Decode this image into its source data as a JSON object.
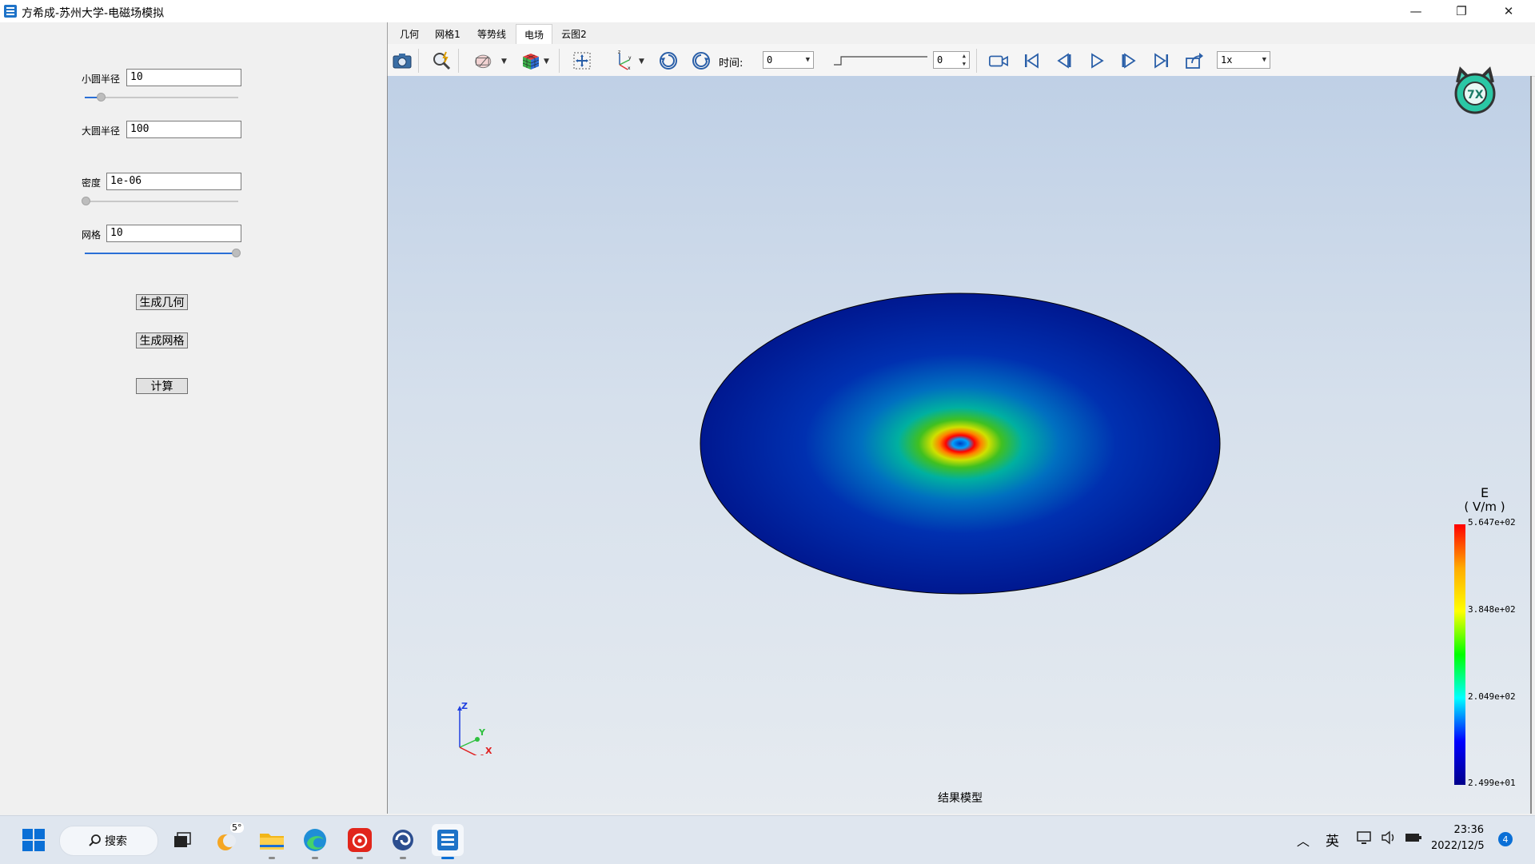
{
  "window": {
    "title": "方希成-苏州大学-电磁场模拟",
    "controls": {
      "minimize": "—",
      "restore": "❐",
      "close": "✕"
    }
  },
  "left_panel": {
    "fields": [
      {
        "label": "小圆半径",
        "value": "10"
      },
      {
        "label": "大圆半径",
        "value": "100"
      },
      {
        "label": "密度",
        "value": "1e-06"
      },
      {
        "label": "网格",
        "value": "10"
      }
    ],
    "sliders": {
      "inner_radius_level": 0.07,
      "density_level": 0.0,
      "grid_level": 1.0
    },
    "buttons": {
      "generate_geometry": "生成几何",
      "generate_mesh": "生成网格",
      "compute": "计算"
    }
  },
  "tabs": [
    {
      "label": "几何",
      "active": false
    },
    {
      "label": "网格1",
      "active": false
    },
    {
      "label": "等势线",
      "active": false
    },
    {
      "label": "电场",
      "active": true
    },
    {
      "label": "云图2",
      "active": false
    }
  ],
  "toolbar": {
    "time_label": "时间:",
    "time_value": "0",
    "step_value": "0",
    "speed_value": "1x"
  },
  "viewport": {
    "caption": "结果模型",
    "axes": {
      "z": "Z",
      "y": "Y",
      "x": "X"
    },
    "logo_text": "7X"
  },
  "colorbar": {
    "quantity": "E",
    "unit": "( V/m )",
    "ticks": [
      "5.647e+02",
      "3.848e+02",
      "2.049e+02",
      "2.499e+01"
    ],
    "colors": [
      "#ff0000",
      "#ffaa00",
      "#ffff00",
      "#00ff00",
      "#00ffff",
      "#0000ff",
      "#00008b"
    ]
  },
  "taskbar": {
    "search_label": "搜索",
    "weather": "5°",
    "ime": "英",
    "time": "23:36",
    "date": "2022/12/5",
    "notification_count": "4"
  }
}
